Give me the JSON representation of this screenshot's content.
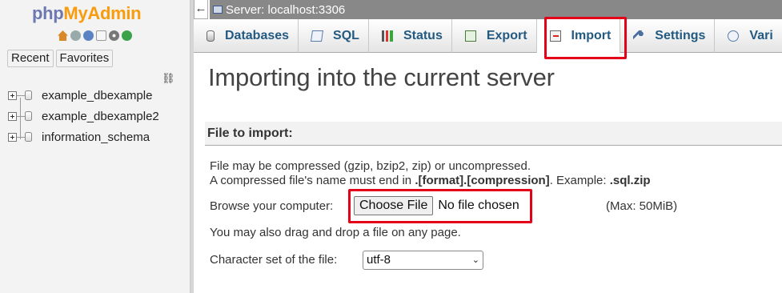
{
  "app": {
    "logo_php": "php",
    "logo_admin": "MyAdmin"
  },
  "sidebar": {
    "nav_icons": [
      "home-icon",
      "logout-icon",
      "help-icon",
      "docs-icon",
      "settings-icon",
      "reload-icon"
    ],
    "recent_label": "Recent",
    "favorites_label": "Favorites",
    "databases": [
      {
        "name": "example_dbexample"
      },
      {
        "name": "example_dbexample2"
      },
      {
        "name": "information_schema"
      }
    ]
  },
  "topbar": {
    "collapse_glyph": "←",
    "server_label": "Server: localhost:3306"
  },
  "tabs": [
    {
      "label": "Databases",
      "icon": "database-icon"
    },
    {
      "label": "SQL",
      "icon": "sql-icon"
    },
    {
      "label": "Status",
      "icon": "status-icon"
    },
    {
      "label": "Export",
      "icon": "export-icon"
    },
    {
      "label": "Import",
      "icon": "import-icon",
      "active": true
    },
    {
      "label": "Settings",
      "icon": "wrench-icon"
    },
    {
      "label": "Vari",
      "icon": "variables-icon"
    }
  ],
  "main": {
    "title": "Importing into the current server",
    "section_title": "File to import:",
    "compress_line1": "File may be compressed (gzip, bzip2, zip) or uncompressed.",
    "compress_line2_prefix": "A compressed file's name must end in ",
    "compress_line2_format": ".[format].[compression]",
    "compress_line2_middle": ". Example: ",
    "compress_line2_example": ".sql.zip",
    "browse_label": "Browse your computer:",
    "choose_file_label": "Choose File",
    "no_file_text": "No file chosen",
    "max_size": "(Max: 50MiB)",
    "drag_drop_text": "You may also drag and drop a file on any page.",
    "charset_label": "Character set of the file:",
    "charset_value": "utf-8"
  },
  "colors": {
    "highlight": "#e5001a",
    "tab_text": "#235a81",
    "logo_php": "#6c78af",
    "logo_admin": "#f89c0e"
  }
}
